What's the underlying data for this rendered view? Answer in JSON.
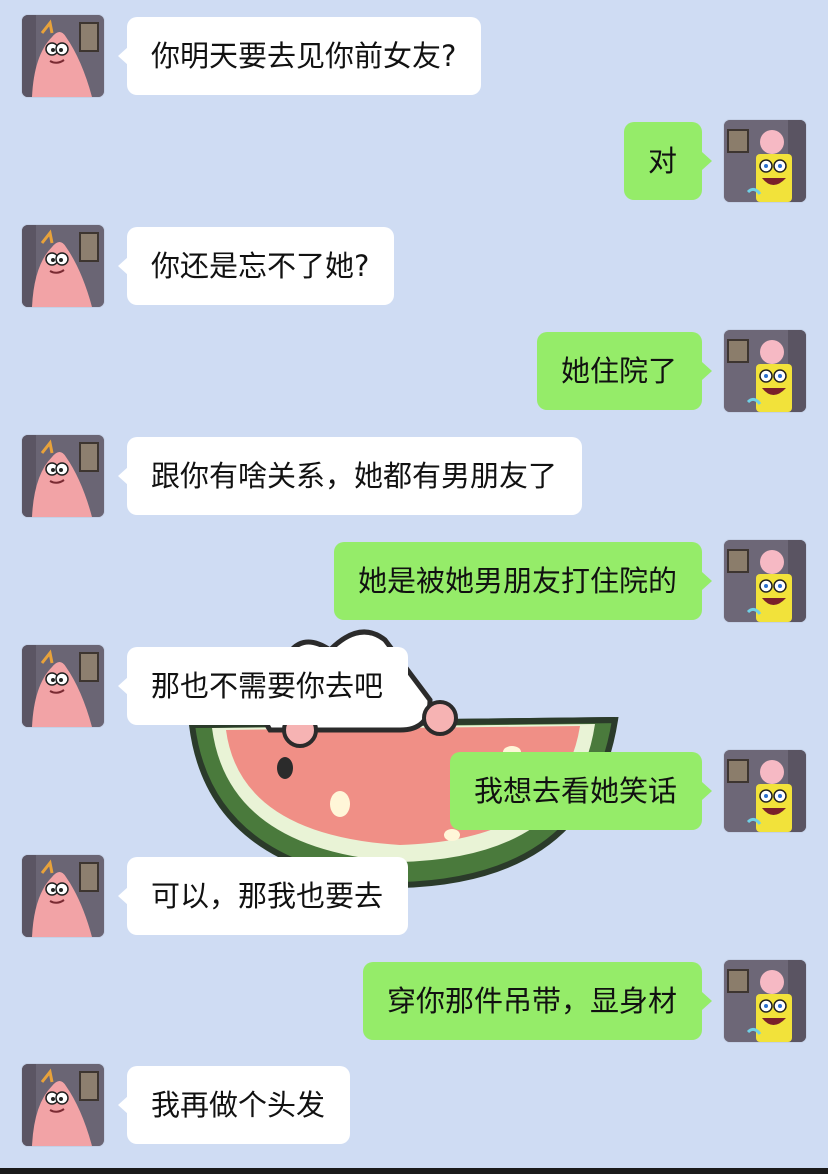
{
  "messages": [
    {
      "side": "left",
      "text": "你明天要去见你前女友?"
    },
    {
      "side": "right",
      "text": "对"
    },
    {
      "side": "left",
      "text": "你还是忘不了她?"
    },
    {
      "side": "right",
      "text": "她住院了"
    },
    {
      "side": "left",
      "text": "跟你有啥关系，她都有男朋友了"
    },
    {
      "side": "right",
      "text": "她是被她男朋友打住院的"
    },
    {
      "side": "left",
      "text": "那也不需要你去吧"
    },
    {
      "side": "right",
      "text": "我想去看她笑话"
    },
    {
      "side": "left",
      "text": "可以，那我也要去"
    },
    {
      "side": "right",
      "text": "穿你那件吊带，显身材"
    },
    {
      "side": "left",
      "text": "我再做个头发"
    }
  ],
  "avatars": {
    "left": "patrick-avatar-icon",
    "right": "spongebob-avatar-icon"
  },
  "colors": {
    "background": "#cfdcf3",
    "left_bubble": "#ffffff",
    "right_bubble": "#95ec69"
  }
}
